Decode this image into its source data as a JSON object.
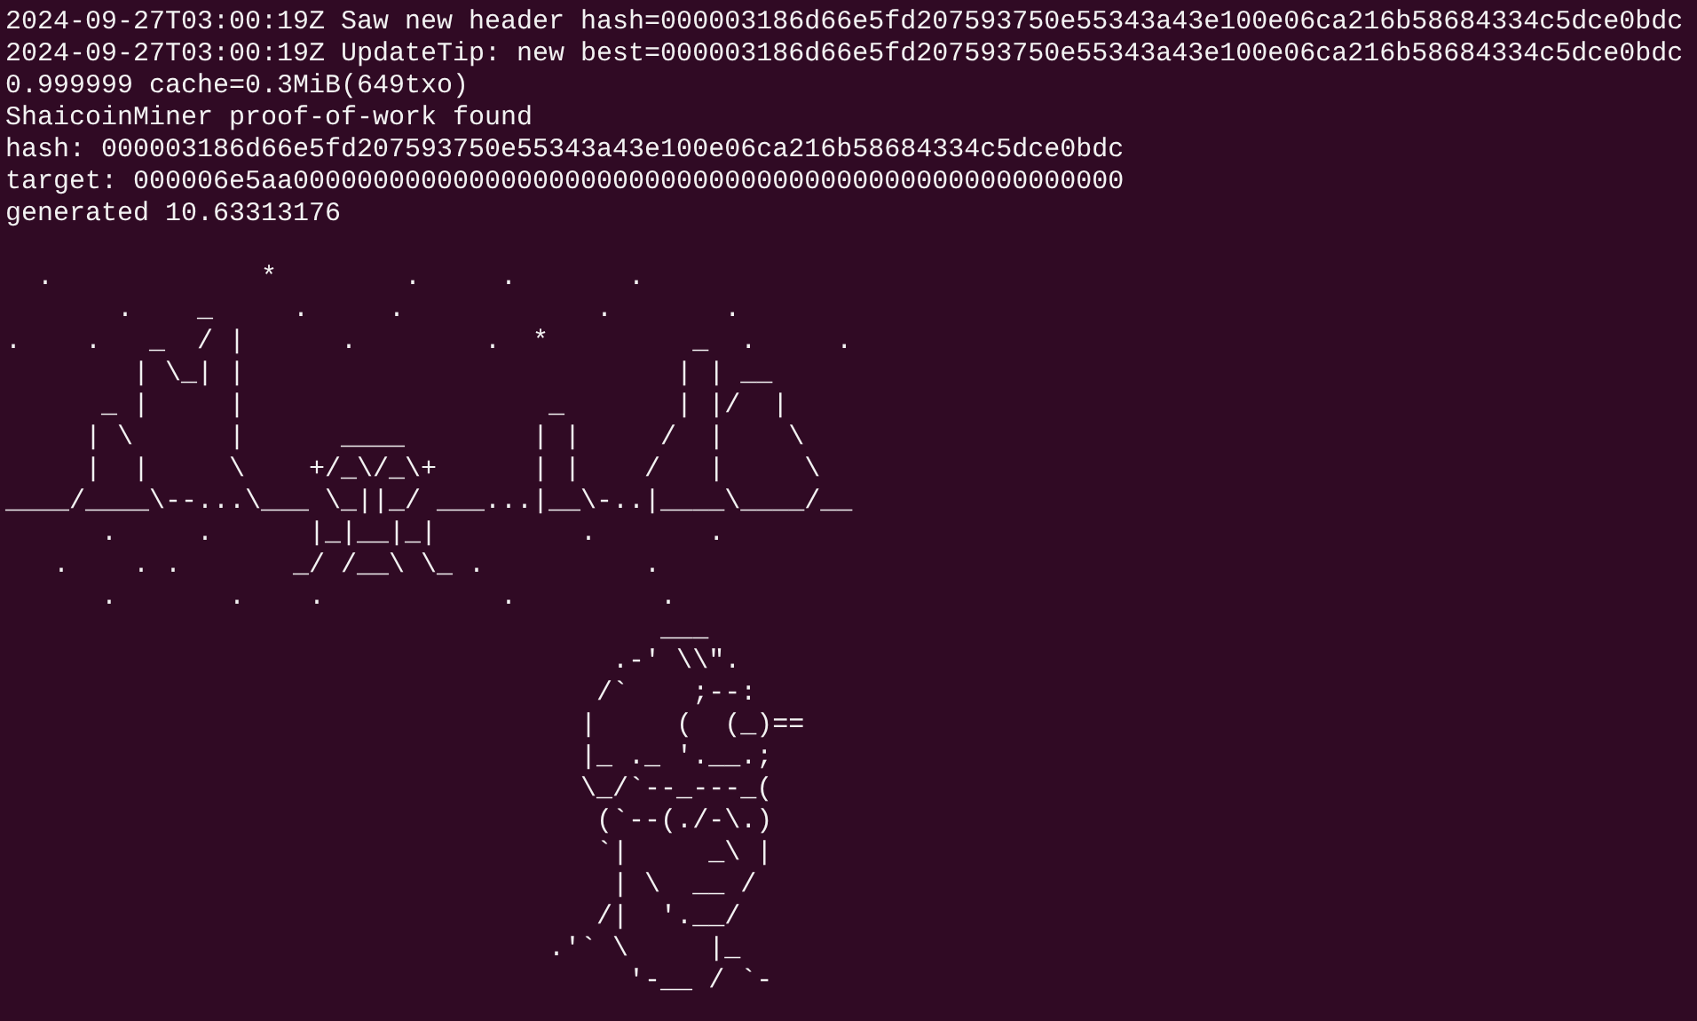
{
  "terminal": {
    "log_lines": [
      "2024-09-27T03:00:19Z Saw new header hash=000003186d66e5fd207593750e55343a43e100e06ca216b58684334c5dce0bdc",
      "2024-09-27T03:00:19Z UpdateTip: new best=000003186d66e5fd207593750e55343a43e100e06ca216b58684334c5dce0bdc",
      "0.999999 cache=0.3MiB(649txo)",
      "ShaicoinMiner proof-of-work found",
      "hash: 000003186d66e5fd207593750e55343a43e100e06ca216b58684334c5dce0bdc",
      "target: 000006e5aa0000000000000000000000000000000000000000000000000000",
      "generated 10.63313176"
    ],
    "ascii_art": [
      "  .             *        .     .       .",
      "       .    _     .     .            .       .",
      ".    .   _  / |      .        .  *         _  .     .",
      "        | \\_| |                           | | __",
      "      _ |     |                   _       | |/  |",
      "     | \\      |      ____        | |     /  |    \\",
      "     |  |     \\    +/_\\/_\\+      | |    /   |     \\",
      "____/____\\--...\\___ \\_||_/ ___...|__\\-..|____\\____/__",
      "      .     .      |_|__|_|         .       .",
      "   .    . .       _/ /__\\ \\_ .          .",
      "      .       .    .           .         .",
      "                                         ___",
      "                                      .-' \\\\\".",
      "                                     /`    ;--:",
      "                                    |     (  (_)==",
      "                                    |_ ._ '.__.;",
      "                                    \\_/`--_---_(",
      "                                     (`--(./-\\.)",
      "                                     `|     _\\ |",
      "                                      | \\  __ /",
      "                                     /|  '.__/",
      "                                  .'` \\     |_",
      "                                       '-__ / `-"
    ]
  }
}
